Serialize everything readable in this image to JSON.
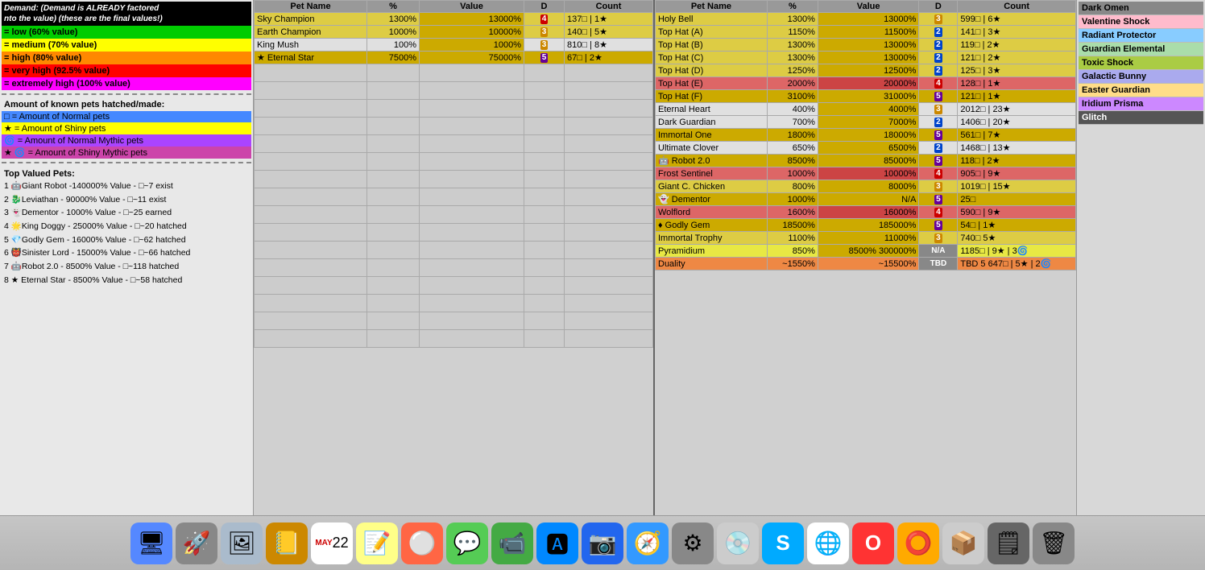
{
  "legend": {
    "demand_header_line1": "Demand: (Demand is ALREADY factored",
    "demand_header_line2": "nto the value) (these are the final values!)",
    "low_label": "= low (60% value)",
    "medium_label": "= medium (70% value)",
    "high_label": "= high (80% value)",
    "very_high_label": "= very high (92.5% value)",
    "extremely_high_label": "= extremely high (100% value)"
  },
  "amounts": {
    "header": "Amount of known pets hatched/made:",
    "normal": "□ = Amount of Normal pets",
    "shiny": "★ = Amount of Shiny pets",
    "normal_mythic": "🌀 = Amount of Normal Mythic pets",
    "shiny_mythic": "★ 🌀 = Amount of Shiny Mythic pets"
  },
  "top_valued": {
    "header": "Top Valued Pets:",
    "items": [
      "1 🤖Giant Robot -140000% Value - □~7 exist",
      "2 🐉Leviathan - 90000% Value - □~11 exist",
      "3 👻Dementor - 1000% Value - □~25 earned",
      "4 🌟King Doggy - 25000% Value - □~20 hatched",
      "5 💎Godly Gem - 16000% Value - □~62 hatched",
      "6 👹Sinister Lord - 15000% Value - □~66 hatched",
      "7 🤖Robot 2.0 - 8500% Value - □~118 hatched",
      "8 ★ Eternal Star - 8500% Value - □~58 hatched"
    ]
  },
  "table1": {
    "rows": [
      {
        "name": "Sky Champion",
        "pct": "1300%",
        "val": "13000%",
        "badge": "4",
        "badge_color": "red",
        "count": "137□ | 1★"
      },
      {
        "name": "Earth Champion",
        "pct": "1000%",
        "val": "10000%",
        "badge": "3",
        "badge_color": "gold",
        "count": "140□ | 5★"
      },
      {
        "name": "King Mush",
        "pct": "100%",
        "val": "1000%",
        "badge": "3",
        "badge_color": "gold",
        "count": "810□ | 8★"
      },
      {
        "name": "★ Eternal Star",
        "pct": "7500%",
        "val": "75000%",
        "badge": "5",
        "badge_color": "purple",
        "count": "67□ | 2★"
      }
    ]
  },
  "table2": {
    "rows": [
      {
        "name": "Holy Bell",
        "pct": "1300%",
        "val": "13000%",
        "badge": "3",
        "badge_color": "gold",
        "count": "599□ | 6★"
      },
      {
        "name": "Top Hat (A)",
        "pct": "1150%",
        "val": "11500%",
        "badge": "2",
        "badge_color": "blue",
        "count": "141□ | 3★"
      },
      {
        "name": "Top Hat (B)",
        "pct": "1300%",
        "val": "13000%",
        "badge": "2",
        "badge_color": "blue",
        "count": "119□ | 2★"
      },
      {
        "name": "Top Hat (C)",
        "pct": "1300%",
        "val": "13000%",
        "badge": "2",
        "badge_color": "blue",
        "count": "121□ | 2★"
      },
      {
        "name": "Top Hat (D)",
        "pct": "1250%",
        "val": "12500%",
        "badge": "2",
        "badge_color": "blue",
        "count": "125□ | 3★"
      },
      {
        "name": "Top Hat (E)",
        "pct": "2000%",
        "val": "20000%",
        "badge": "4",
        "badge_color": "red",
        "count": "128□ | 1★"
      },
      {
        "name": "Top Hat (F)",
        "pct": "3100%",
        "val": "31000%",
        "badge": "5",
        "badge_color": "purple",
        "count": "121□ | 1★"
      },
      {
        "name": "Eternal Heart",
        "pct": "400%",
        "val": "4000%",
        "badge": "3",
        "badge_color": "gold",
        "count": "2012□ | 23★"
      },
      {
        "name": "Dark Guardian",
        "pct": "700%",
        "val": "7000%",
        "badge": "2",
        "badge_color": "blue",
        "count": "1406□ | 20★"
      },
      {
        "name": "Immortal One",
        "pct": "1800%",
        "val": "18000%",
        "badge": "5",
        "badge_color": "purple",
        "count": "561□ | 7★"
      },
      {
        "name": "Ultimate Clover",
        "pct": "650%",
        "val": "6500%",
        "badge": "2",
        "badge_color": "blue",
        "count": "1468□ | 13★"
      },
      {
        "name": "🤖 Robot 2.0",
        "pct": "8500%",
        "val": "85000%",
        "badge": "5",
        "badge_color": "purple",
        "count": "118□ | 2★"
      },
      {
        "name": "Frost Sentinel",
        "pct": "1000%",
        "val": "10000%",
        "badge": "4",
        "badge_color": "red",
        "count": "905□ | 9★"
      },
      {
        "name": "Giant C. Chicken",
        "pct": "800%",
        "val": "8000%",
        "badge": "3",
        "badge_color": "gold",
        "count": "1019□ | 15★"
      },
      {
        "name": "👻 Dementor",
        "pct": "1000%",
        "val": "N/A",
        "badge": "5",
        "badge_color": "purple",
        "count": "25□"
      },
      {
        "name": "Wolflord",
        "pct": "1600%",
        "val": "16000%",
        "badge": "4",
        "badge_color": "red",
        "count": "590□ | 9★"
      },
      {
        "name": "♦ Godly Gem",
        "pct": "18500%",
        "val": "185000%",
        "badge": "5",
        "badge_color": "purple",
        "count": "54□ | 1★"
      },
      {
        "name": "Immortal Trophy",
        "pct": "1100%",
        "val": "11000%",
        "badge": "3",
        "badge_color": "gold",
        "count": "740□ 5★"
      },
      {
        "name": "Pyramidium",
        "pct": "850%",
        "val": "8500% 300000%",
        "badge": "N/A",
        "badge_color": "gray",
        "count": "1185□ | 9★ | 3🌀"
      },
      {
        "name": "Duality",
        "pct": "~1550%",
        "val": "~15500%",
        "badge": "TBD",
        "badge_color": "gray",
        "count": "TBD 5 647□ | 5★ | 2🌀"
      }
    ]
  },
  "right_panel": {
    "items": [
      {
        "name": "Dark Omen",
        "color": "dark"
      },
      {
        "name": "Valentine Shock",
        "color": "pink"
      },
      {
        "name": "Radiant Protector",
        "color": "blue"
      },
      {
        "name": "Guardian Elemental",
        "color": "green"
      },
      {
        "name": "Toxic Shock",
        "color": "lime"
      },
      {
        "name": "Galactic Bunny",
        "color": "lavender"
      },
      {
        "name": "Easter Guardian",
        "color": "yellow"
      },
      {
        "name": "Iridium Prisma",
        "color": "purple"
      },
      {
        "name": "Glitch",
        "color": "darkgray"
      }
    ]
  },
  "dock": {
    "icons": [
      {
        "name": "finder",
        "emoji": "🖥",
        "bg": "#4488ff"
      },
      {
        "name": "launchpad",
        "emoji": "🚀",
        "bg": "#888"
      },
      {
        "name": "photos",
        "emoji": "🖼",
        "bg": "#888"
      },
      {
        "name": "contacts",
        "emoji": "📒",
        "bg": "#cc8800"
      },
      {
        "name": "calendar",
        "emoji": "📅",
        "bg": "#fff"
      },
      {
        "name": "notes",
        "emoji": "📝",
        "bg": "#ffff88"
      },
      {
        "name": "reminders",
        "emoji": "⚪",
        "bg": "#ff6644"
      },
      {
        "name": "messages",
        "emoji": "💬",
        "bg": "#44cc44"
      },
      {
        "name": "facetime",
        "emoji": "📹",
        "bg": "#44aa44"
      },
      {
        "name": "appstore",
        "emoji": "🅰",
        "bg": "#0088ff"
      },
      {
        "name": "zoom",
        "emoji": "📷",
        "bg": "#2266ee"
      },
      {
        "name": "safari",
        "emoji": "🧭",
        "bg": "#3399ff"
      },
      {
        "name": "systemprefs",
        "emoji": "⚙",
        "bg": "#888"
      },
      {
        "name": "dvd",
        "emoji": "💿",
        "bg": "#cccccc"
      },
      {
        "name": "skype",
        "emoji": "S",
        "bg": "#00aaff"
      },
      {
        "name": "chrome",
        "emoji": "🌐",
        "bg": "#fff"
      },
      {
        "name": "opera",
        "emoji": "O",
        "bg": "#ff3333"
      },
      {
        "name": "another",
        "emoji": "⭕",
        "bg": "#ffaa00"
      },
      {
        "name": "another2",
        "emoji": "📦",
        "bg": "#cccccc"
      },
      {
        "name": "screenshots",
        "emoji": "🗒",
        "bg": "#555"
      },
      {
        "name": "trash",
        "emoji": "🗑",
        "bg": "#888"
      }
    ]
  }
}
